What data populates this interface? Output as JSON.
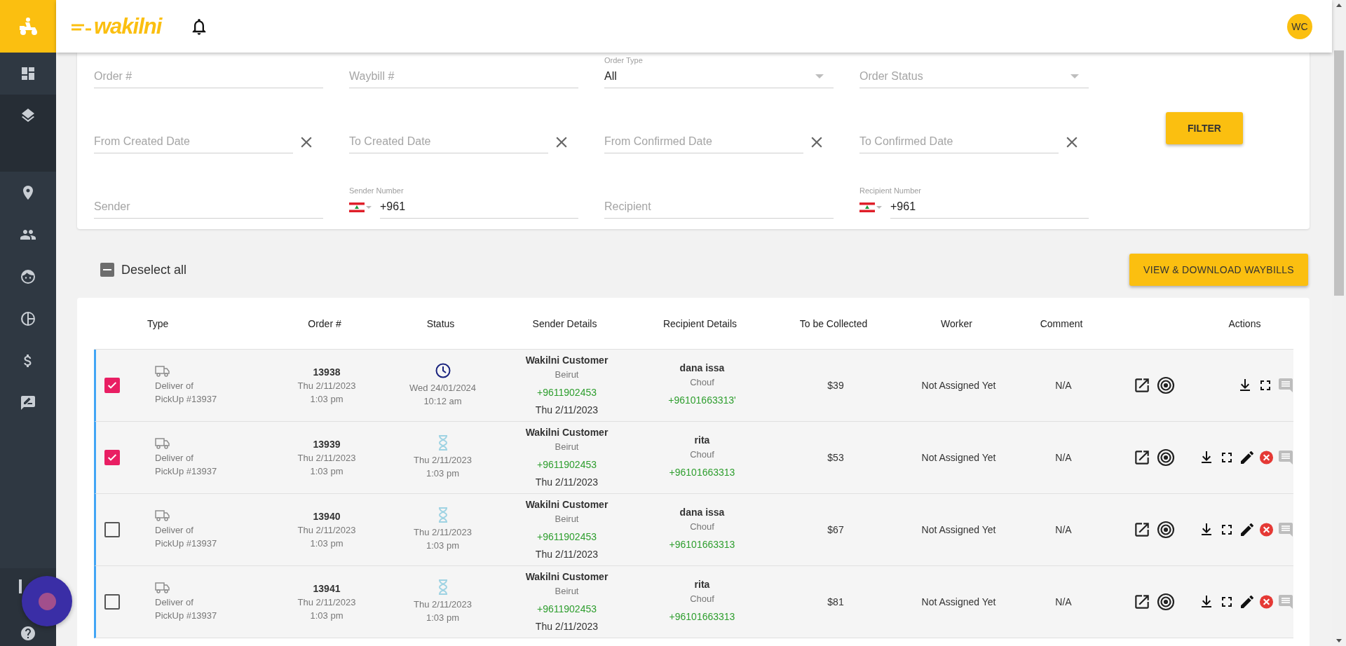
{
  "sidebar": {
    "items": [
      {
        "kind": "dashboard",
        "selected": false
      },
      {
        "kind": "layers",
        "selected": true
      },
      {
        "kind": "location",
        "selected": false
      },
      {
        "kind": "people",
        "selected": false
      },
      {
        "kind": "face",
        "selected": false
      },
      {
        "kind": "pie",
        "selected": false
      },
      {
        "kind": "dollar",
        "selected": false
      },
      {
        "kind": "feedback",
        "selected": false
      }
    ],
    "footer_items": [
      {
        "kind": "document"
      },
      {
        "kind": "help"
      }
    ]
  },
  "header": {
    "logo": "wakilni",
    "avatar": "WC"
  },
  "filters": {
    "fields": [
      {
        "kind": "text",
        "placeholder": "Order #"
      },
      {
        "kind": "text",
        "placeholder": "Waybill #"
      },
      {
        "kind": "select",
        "label": "Order Type",
        "value": "All"
      },
      {
        "kind": "select",
        "placeholder": "Order Status"
      },
      {
        "kind": "date",
        "placeholder": "From Created Date"
      },
      {
        "kind": "date",
        "placeholder": "To Created Date"
      },
      {
        "kind": "date",
        "placeholder": "From Confirmed Date"
      },
      {
        "kind": "date",
        "placeholder": "To Confirmed Date"
      },
      {
        "kind": "text",
        "placeholder": "Sender"
      },
      {
        "kind": "phone",
        "label": "Sender Number",
        "value": "+961"
      },
      {
        "kind": "text",
        "placeholder": "Recipient"
      },
      {
        "kind": "phone",
        "label": "Recipient Number",
        "value": "+961"
      }
    ],
    "button": "FILTER"
  },
  "deselect_all": {
    "label": "Deselect all",
    "indeterminate": true
  },
  "download_button": "VIEW & DOWNLOAD WAYBILLS",
  "table": {
    "columns": [
      "Type",
      "Order #",
      "Status",
      "Sender Details",
      "Recipient Details",
      "To be Collected",
      "Worker",
      "Comment",
      "Actions"
    ],
    "rows": [
      {
        "selected": true,
        "type_label": "Deliver of",
        "pickup_ref": "PickUp #13937",
        "order_number": "13938",
        "order_date": "Thu 2/11/2023",
        "order_time": "1:03 pm",
        "status": {
          "kind": "scheduled",
          "date": "Wed 24/01/2024",
          "time": "10:12 am"
        },
        "sender": {
          "name": "Wakilni Customer",
          "city": "Beirut",
          "phone": "+9611902453",
          "date": "Thu 2/11/2023"
        },
        "recipient": {
          "name": "dana issa",
          "city": "Chouf",
          "phone": "+96101663313'"
        },
        "to_be_collected": "$39",
        "worker": "Not Assigned Yet",
        "comment": "N/A",
        "actions": [
          {
            "kind": "download"
          },
          {
            "kind": "expand"
          },
          {
            "kind": "comment"
          }
        ]
      },
      {
        "selected": true,
        "type_label": "Deliver of",
        "pickup_ref": "PickUp #13937",
        "order_number": "13939",
        "order_date": "Thu 2/11/2023",
        "order_time": "1:03 pm",
        "status": {
          "kind": "pending",
          "date": "Thu 2/11/2023",
          "time": "1:03 pm"
        },
        "sender": {
          "name": "Wakilni Customer",
          "city": "Beirut",
          "phone": "+9611902453",
          "date": "Thu 2/11/2023"
        },
        "recipient": {
          "name": "rita",
          "city": "Chouf",
          "phone": "+96101663313"
        },
        "to_be_collected": "$53",
        "worker": "Not Assigned Yet",
        "comment": "N/A",
        "actions": [
          {
            "kind": "download"
          },
          {
            "kind": "expand"
          },
          {
            "kind": "edit"
          },
          {
            "kind": "cancel"
          },
          {
            "kind": "comment"
          }
        ]
      },
      {
        "selected": false,
        "type_label": "Deliver of",
        "pickup_ref": "PickUp #13937",
        "order_number": "13940",
        "order_date": "Thu 2/11/2023",
        "order_time": "1:03 pm",
        "status": {
          "kind": "pending",
          "date": "Thu 2/11/2023",
          "time": "1:03 pm"
        },
        "sender": {
          "name": "Wakilni Customer",
          "city": "Beirut",
          "phone": "+9611902453",
          "date": "Thu 2/11/2023"
        },
        "recipient": {
          "name": "dana issa",
          "city": "Chouf",
          "phone": "+96101663313"
        },
        "to_be_collected": "$67",
        "worker": "Not Assigned Yet",
        "comment": "N/A",
        "actions": [
          {
            "kind": "download"
          },
          {
            "kind": "expand"
          },
          {
            "kind": "edit"
          },
          {
            "kind": "cancel"
          },
          {
            "kind": "comment"
          }
        ]
      },
      {
        "selected": false,
        "type_label": "Deliver of",
        "pickup_ref": "PickUp #13937",
        "order_number": "13941",
        "order_date": "Thu 2/11/2023",
        "order_time": "1:03 pm",
        "status": {
          "kind": "pending",
          "date": "Thu 2/11/2023",
          "time": "1:03 pm"
        },
        "sender": {
          "name": "Wakilni Customer",
          "city": "Beirut",
          "phone": "+9611902453",
          "date": "Thu 2/11/2023"
        },
        "recipient": {
          "name": "rita",
          "city": "Chouf",
          "phone": "+96101663313"
        },
        "to_be_collected": "$81",
        "worker": "Not Assigned Yet",
        "comment": "N/A",
        "actions": [
          {
            "kind": "download"
          },
          {
            "kind": "expand"
          },
          {
            "kind": "edit"
          },
          {
            "kind": "cancel"
          },
          {
            "kind": "comment"
          }
        ]
      }
    ]
  }
}
